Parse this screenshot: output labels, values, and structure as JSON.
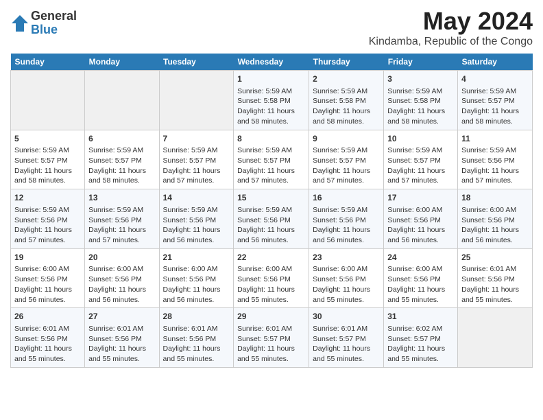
{
  "logo": {
    "general": "General",
    "blue": "Blue"
  },
  "title": "May 2024",
  "subtitle": "Kindamba, Republic of the Congo",
  "weekdays": [
    "Sunday",
    "Monday",
    "Tuesday",
    "Wednesday",
    "Thursday",
    "Friday",
    "Saturday"
  ],
  "weeks": [
    [
      {
        "day": "",
        "info": ""
      },
      {
        "day": "",
        "info": ""
      },
      {
        "day": "",
        "info": ""
      },
      {
        "day": "1",
        "info": "Sunrise: 5:59 AM\nSunset: 5:58 PM\nDaylight: 11 hours and 58 minutes."
      },
      {
        "day": "2",
        "info": "Sunrise: 5:59 AM\nSunset: 5:58 PM\nDaylight: 11 hours and 58 minutes."
      },
      {
        "day": "3",
        "info": "Sunrise: 5:59 AM\nSunset: 5:58 PM\nDaylight: 11 hours and 58 minutes."
      },
      {
        "day": "4",
        "info": "Sunrise: 5:59 AM\nSunset: 5:57 PM\nDaylight: 11 hours and 58 minutes."
      }
    ],
    [
      {
        "day": "5",
        "info": "Sunrise: 5:59 AM\nSunset: 5:57 PM\nDaylight: 11 hours and 58 minutes."
      },
      {
        "day": "6",
        "info": "Sunrise: 5:59 AM\nSunset: 5:57 PM\nDaylight: 11 hours and 58 minutes."
      },
      {
        "day": "7",
        "info": "Sunrise: 5:59 AM\nSunset: 5:57 PM\nDaylight: 11 hours and 57 minutes."
      },
      {
        "day": "8",
        "info": "Sunrise: 5:59 AM\nSunset: 5:57 PM\nDaylight: 11 hours and 57 minutes."
      },
      {
        "day": "9",
        "info": "Sunrise: 5:59 AM\nSunset: 5:57 PM\nDaylight: 11 hours and 57 minutes."
      },
      {
        "day": "10",
        "info": "Sunrise: 5:59 AM\nSunset: 5:57 PM\nDaylight: 11 hours and 57 minutes."
      },
      {
        "day": "11",
        "info": "Sunrise: 5:59 AM\nSunset: 5:56 PM\nDaylight: 11 hours and 57 minutes."
      }
    ],
    [
      {
        "day": "12",
        "info": "Sunrise: 5:59 AM\nSunset: 5:56 PM\nDaylight: 11 hours and 57 minutes."
      },
      {
        "day": "13",
        "info": "Sunrise: 5:59 AM\nSunset: 5:56 PM\nDaylight: 11 hours and 57 minutes."
      },
      {
        "day": "14",
        "info": "Sunrise: 5:59 AM\nSunset: 5:56 PM\nDaylight: 11 hours and 56 minutes."
      },
      {
        "day": "15",
        "info": "Sunrise: 5:59 AM\nSunset: 5:56 PM\nDaylight: 11 hours and 56 minutes."
      },
      {
        "day": "16",
        "info": "Sunrise: 5:59 AM\nSunset: 5:56 PM\nDaylight: 11 hours and 56 minutes."
      },
      {
        "day": "17",
        "info": "Sunrise: 6:00 AM\nSunset: 5:56 PM\nDaylight: 11 hours and 56 minutes."
      },
      {
        "day": "18",
        "info": "Sunrise: 6:00 AM\nSunset: 5:56 PM\nDaylight: 11 hours and 56 minutes."
      }
    ],
    [
      {
        "day": "19",
        "info": "Sunrise: 6:00 AM\nSunset: 5:56 PM\nDaylight: 11 hours and 56 minutes."
      },
      {
        "day": "20",
        "info": "Sunrise: 6:00 AM\nSunset: 5:56 PM\nDaylight: 11 hours and 56 minutes."
      },
      {
        "day": "21",
        "info": "Sunrise: 6:00 AM\nSunset: 5:56 PM\nDaylight: 11 hours and 56 minutes."
      },
      {
        "day": "22",
        "info": "Sunrise: 6:00 AM\nSunset: 5:56 PM\nDaylight: 11 hours and 55 minutes."
      },
      {
        "day": "23",
        "info": "Sunrise: 6:00 AM\nSunset: 5:56 PM\nDaylight: 11 hours and 55 minutes."
      },
      {
        "day": "24",
        "info": "Sunrise: 6:00 AM\nSunset: 5:56 PM\nDaylight: 11 hours and 55 minutes."
      },
      {
        "day": "25",
        "info": "Sunrise: 6:01 AM\nSunset: 5:56 PM\nDaylight: 11 hours and 55 minutes."
      }
    ],
    [
      {
        "day": "26",
        "info": "Sunrise: 6:01 AM\nSunset: 5:56 PM\nDaylight: 11 hours and 55 minutes."
      },
      {
        "day": "27",
        "info": "Sunrise: 6:01 AM\nSunset: 5:56 PM\nDaylight: 11 hours and 55 minutes."
      },
      {
        "day": "28",
        "info": "Sunrise: 6:01 AM\nSunset: 5:56 PM\nDaylight: 11 hours and 55 minutes."
      },
      {
        "day": "29",
        "info": "Sunrise: 6:01 AM\nSunset: 5:57 PM\nDaylight: 11 hours and 55 minutes."
      },
      {
        "day": "30",
        "info": "Sunrise: 6:01 AM\nSunset: 5:57 PM\nDaylight: 11 hours and 55 minutes."
      },
      {
        "day": "31",
        "info": "Sunrise: 6:02 AM\nSunset: 5:57 PM\nDaylight: 11 hours and 55 minutes."
      },
      {
        "day": "",
        "info": ""
      }
    ]
  ]
}
